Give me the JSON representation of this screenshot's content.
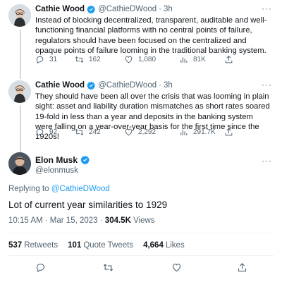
{
  "tweets": [
    {
      "name": "Cathie Wood",
      "handle": "@CathieDWood",
      "time": "3h",
      "text": "Instead of blocking decentralized, transparent, auditable and well-functioning financial platforms with no central points of failure, regulators should have been focused on the centralized and opaque points of failure looming in the traditional banking system.",
      "replies": "31",
      "retweets": "162",
      "likes": "1,080",
      "views": "81K"
    },
    {
      "name": "Cathie Wood",
      "handle": "@CathieDWood",
      "time": "3h",
      "text": "They should have been all over the crisis that was looming in plain sight: asset and liability duration mismatches as short rates soared 19-fold in less than a year and deposits in the banking system were falling on a year-over-year basis for the first time since the 1920s!",
      "replies": "92",
      "retweets": "242",
      "likes": "2,292",
      "views": "291.7K"
    }
  ],
  "main": {
    "name": "Elon Musk",
    "handle": "@elonmusk",
    "replying_prefix": "Replying to",
    "replying_to": "@CathieDWood",
    "text": "Lot of current year similarities to 1929",
    "timestamp": "10:15 AM · Mar 15, 2023 · ",
    "views_count": "304.5K",
    "views_label": " Views",
    "retweets_count": "537",
    "retweets_label": "Retweets",
    "quotes_count": "101",
    "quotes_label": "Quote Tweets",
    "likes_count": "4,664",
    "likes_label": "Likes"
  },
  "icons": {
    "more": "more-icon",
    "reply": "reply-icon",
    "retweet": "retweet-icon",
    "like": "heart-icon",
    "views": "views-icon",
    "share": "share-icon",
    "verified": "verified-badge-icon"
  },
  "colors": {
    "accent": "#1d9bf0",
    "text": "#0f1419",
    "secondary": "#536471"
  }
}
